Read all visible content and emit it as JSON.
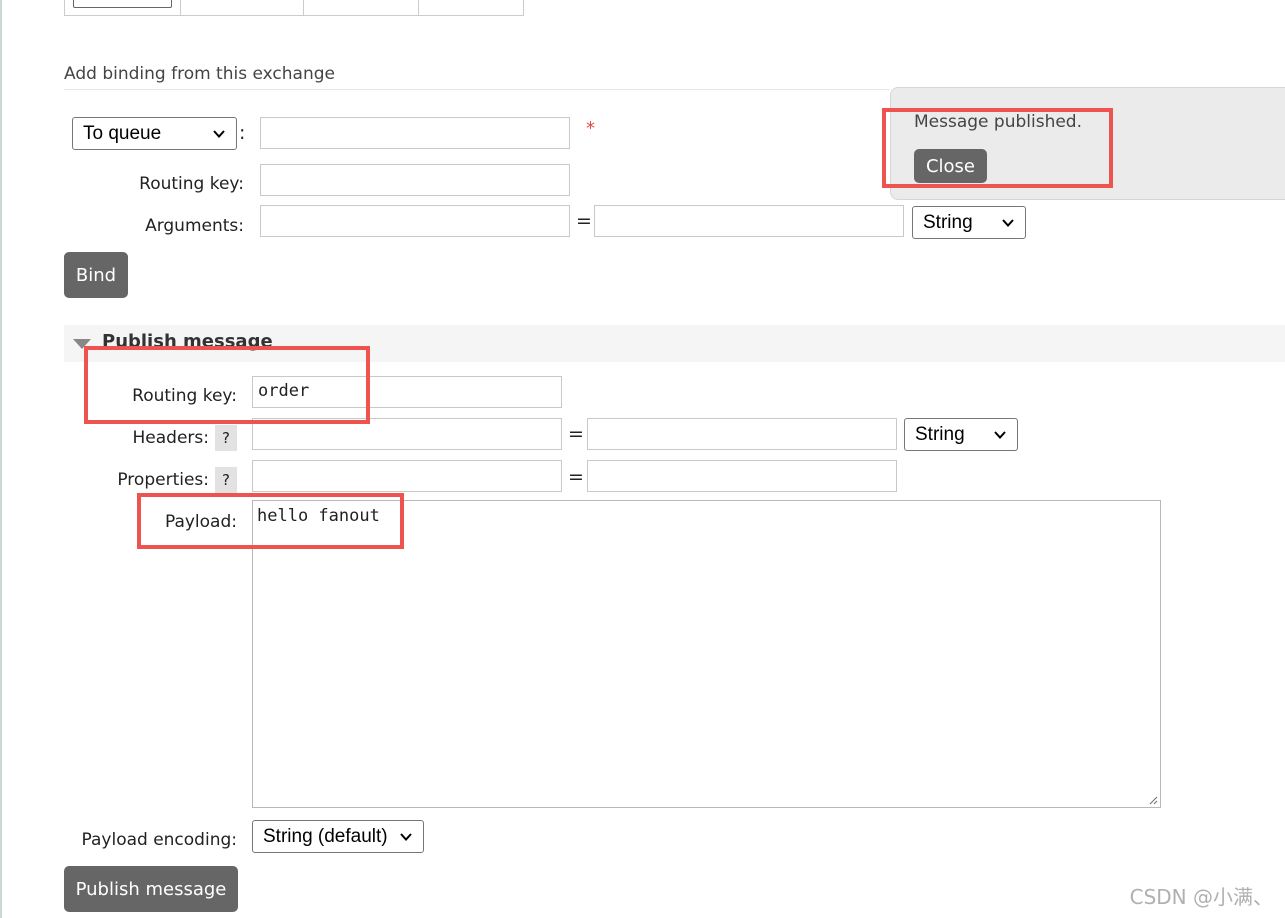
{
  "binding": {
    "section_title": "Add binding from this exchange",
    "destination_select": "To queue",
    "colon": ":",
    "required_mark": "*",
    "routing_key_label": "Routing key:",
    "arguments_label": "Arguments:",
    "equals": "=",
    "arguments_type": "String",
    "bind_button": "Bind"
  },
  "toast": {
    "message": "Message published.",
    "close_button": "Close"
  },
  "publish": {
    "section_title": "Publish message",
    "routing_key_label": "Routing key:",
    "routing_key_value": "order",
    "headers_label": "Headers:",
    "headers_help": "?",
    "headers_type": "String",
    "properties_label": "Properties:",
    "properties_help": "?",
    "equals": "=",
    "payload_label": "Payload:",
    "payload_value": "hello fanout",
    "payload_encoding_label": "Payload encoding:",
    "payload_encoding_value": "String (default)",
    "publish_button": "Publish message"
  },
  "watermark": "CSDN @小满、"
}
